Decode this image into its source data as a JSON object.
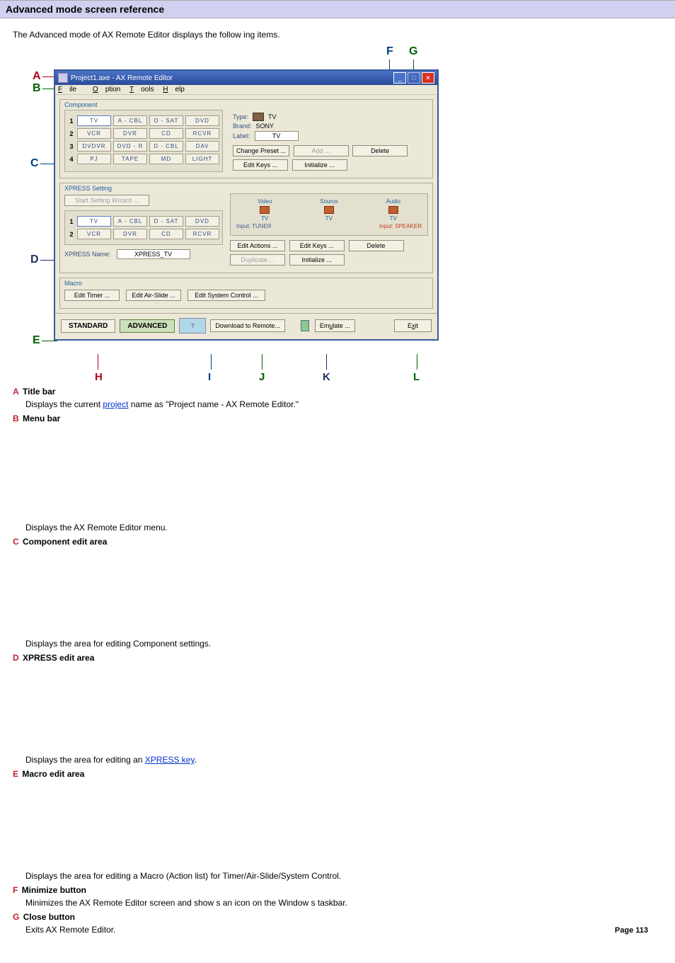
{
  "page": {
    "title": "Advanced mode screen reference",
    "intro": "The Advanced mode of AX Remote Editor displays the follow ing items.",
    "page_number": "Page 113"
  },
  "callouts": {
    "A": "A",
    "B": "B",
    "C": "C",
    "D": "D",
    "E": "E",
    "F": "F",
    "G": "G",
    "H": "H",
    "I": "I",
    "J": "J",
    "K": "K",
    "L": "L"
  },
  "window": {
    "title": "Project1.axe - AX Remote Editor",
    "menu": {
      "file": "File",
      "option": "Option",
      "tools": "Tools",
      "help": "Help"
    },
    "component": {
      "legend": "Component",
      "rows": [
        {
          "n": "1",
          "cells": [
            "TV",
            "A - CBL",
            "D - SAT",
            "DVD"
          ]
        },
        {
          "n": "2",
          "cells": [
            "VCR",
            "DVR",
            "CD",
            "RCVR"
          ]
        },
        {
          "n": "3",
          "cells": [
            "DVDVR",
            "DVD - R",
            "D - CBL",
            "DAV"
          ]
        },
        {
          "n": "4",
          "cells": [
            "PJ",
            "TAPE",
            "MD",
            "LIGHT"
          ]
        }
      ],
      "type_label": "Type:",
      "type_value": "TV",
      "brand_label": "Brand:",
      "brand_value": "SONY",
      "label_label": "Label:",
      "label_value": "TV",
      "btn_change_preset": "Change Preset ...",
      "btn_add": "Add ...",
      "btn_delete": "Delete",
      "btn_edit_keys": "Edit Keys ...",
      "btn_initialize": "Initialize ..."
    },
    "xpress": {
      "legend": "XPRESS Setting",
      "btn_wizard": "Start Setting Wizard ...",
      "rows": [
        {
          "n": "1",
          "cells": [
            "TV",
            "A - CBL",
            "D - SAT",
            "DVD"
          ]
        },
        {
          "n": "2",
          "cells": [
            "VCR",
            "DVR",
            "CD",
            "RCVR"
          ]
        }
      ],
      "name_label": "XPRESS Name:",
      "name_value": "XPRESS_TV",
      "video_h": "Video",
      "source_h": "Source",
      "audio_h": "Audio",
      "video_v": "TV",
      "source_v": "TV",
      "audio_v": "TV",
      "inp_left": "Input: TUNER",
      "inp_right": "Input: SPEAKER",
      "btn_edit_actions": "Edit Actions ...",
      "btn_edit_keys": "Edit Keys ...",
      "btn_delete": "Delete",
      "btn_duplicate": "Duplicate ...",
      "btn_initialize": "Initialize ..."
    },
    "macro": {
      "legend": "Macro",
      "btn_timer": "Edit Timer ...",
      "btn_airslide": "Edit Air-Slide ...",
      "btn_system": "Edit System Control ..."
    },
    "bottom": {
      "standard": "STANDARD",
      "advanced": "ADVANCED",
      "download": "Download to Remote...",
      "emulate": "Emulate ...",
      "exit": "Exit"
    }
  },
  "defs": {
    "A": {
      "term": "Title bar",
      "desc_pre": "Displays the current ",
      "link": "project",
      "desc_post": " name as \"Project name - AX Remote Editor.\""
    },
    "B": {
      "term": "Menu bar",
      "desc": "Displays the AX Remote Editor menu."
    },
    "C": {
      "term": "Component edit area",
      "desc": "Displays the area for editing Component settings."
    },
    "D": {
      "term": "XPRESS edit area",
      "desc_pre": "Displays the area for editing an ",
      "link": "XPRESS key",
      "desc_post": "."
    },
    "E": {
      "term": "Macro edit area",
      "desc": "Displays the area for editing a Macro (Action list) for Timer/Air-Slide/System Control."
    },
    "F": {
      "term": "Minimize button",
      "desc": "Minimizes the AX Remote Editor screen and show s an icon on the Window s taskbar."
    },
    "G": {
      "term": "Close button",
      "desc": "Exits AX Remote Editor."
    }
  }
}
